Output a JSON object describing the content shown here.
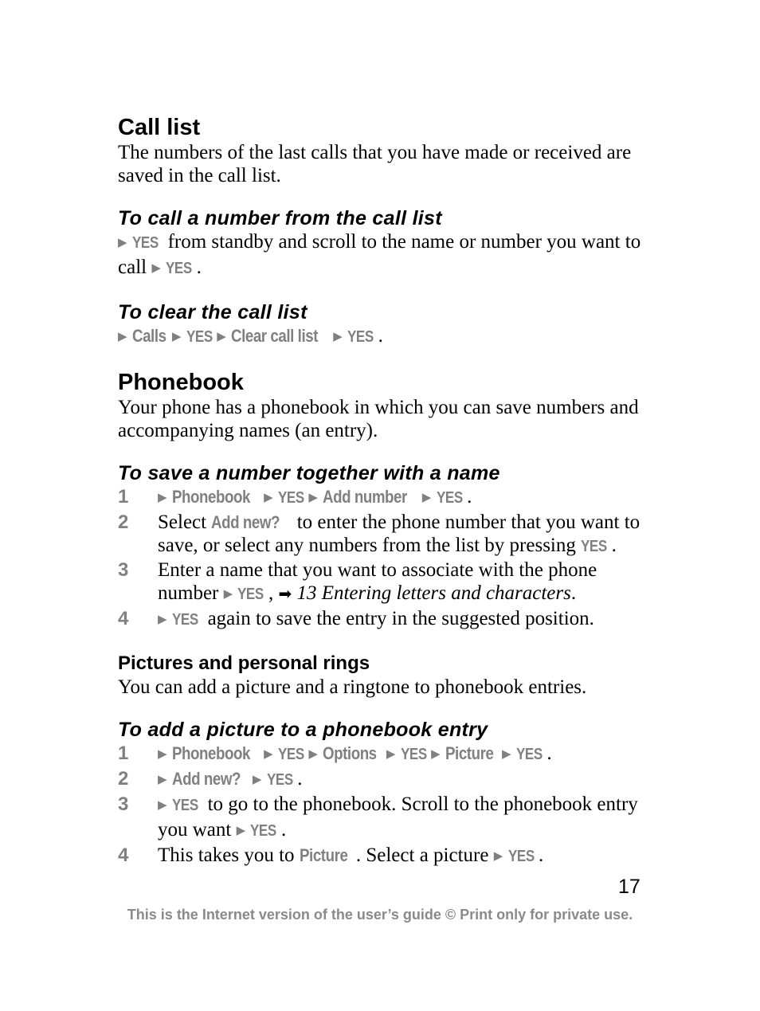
{
  "sections": {
    "call_list": {
      "title": "Call list",
      "intro": "The numbers of the last calls that you have made or received are saved in the call list.",
      "call_number": {
        "title": "To call a number from the call list",
        "key1": "YES",
        "text1": " from standby and scroll to the name or number you want to call ",
        "key2": "YES",
        "end": "."
      },
      "clear": {
        "title": "To clear the call list",
        "items": [
          "Calls",
          "YES",
          "Clear call list",
          "YES"
        ],
        "end": "."
      }
    },
    "phonebook": {
      "title": "Phonebook",
      "intro": "Your phone has a phonebook in which you can save numbers and accompanying names (an entry).",
      "save": {
        "title": "To save a number together with a name",
        "steps": [
          {
            "num": "1",
            "items": [
              "Phonebook",
              "YES",
              "Add number",
              "YES"
            ],
            "end": "."
          },
          {
            "num": "2",
            "pre": "Select ",
            "key": "Add new?",
            "text": " to enter the phone number that you want to save, or select any numbers from the list by pressing ",
            "key2": "YES",
            "end": "."
          },
          {
            "num": "3",
            "text": "Enter a name that you want to associate with the phone number ",
            "key": "YES",
            "sep": ", ",
            "ref_icon": "right-arrow-reference-icon",
            "ref": "13 Entering letters and characters",
            "end": "."
          },
          {
            "num": "4",
            "key": "YES",
            "text": " again to save the entry in the suggested position."
          }
        ]
      }
    },
    "pictures": {
      "title": "Pictures and personal rings",
      "intro": "You can add a picture and a ringtone to phonebook entries.",
      "add_picture": {
        "title": "To add a picture to a phonebook entry",
        "steps": [
          {
            "num": "1",
            "items": [
              "Phonebook",
              "YES",
              "Options",
              "YES",
              "Picture",
              "YES"
            ],
            "end": "."
          },
          {
            "num": "2",
            "items": [
              "Add new?",
              "YES"
            ],
            "end": "."
          },
          {
            "num": "3",
            "key": "YES",
            "text": " to go to the phonebook. Scroll to the phonebook entry you want ",
            "key2": "YES",
            "end": "."
          },
          {
            "num": "4",
            "pre": "This takes you to ",
            "key": "Picture",
            "text": ". Select a picture ",
            "key2": "YES",
            "end": "."
          }
        ]
      }
    }
  },
  "page_number": "17",
  "footer": "This is the Internet version of the user’s guide © Print only for private use.",
  "colors": {
    "key_gray": "#808080",
    "text": "#000000"
  }
}
